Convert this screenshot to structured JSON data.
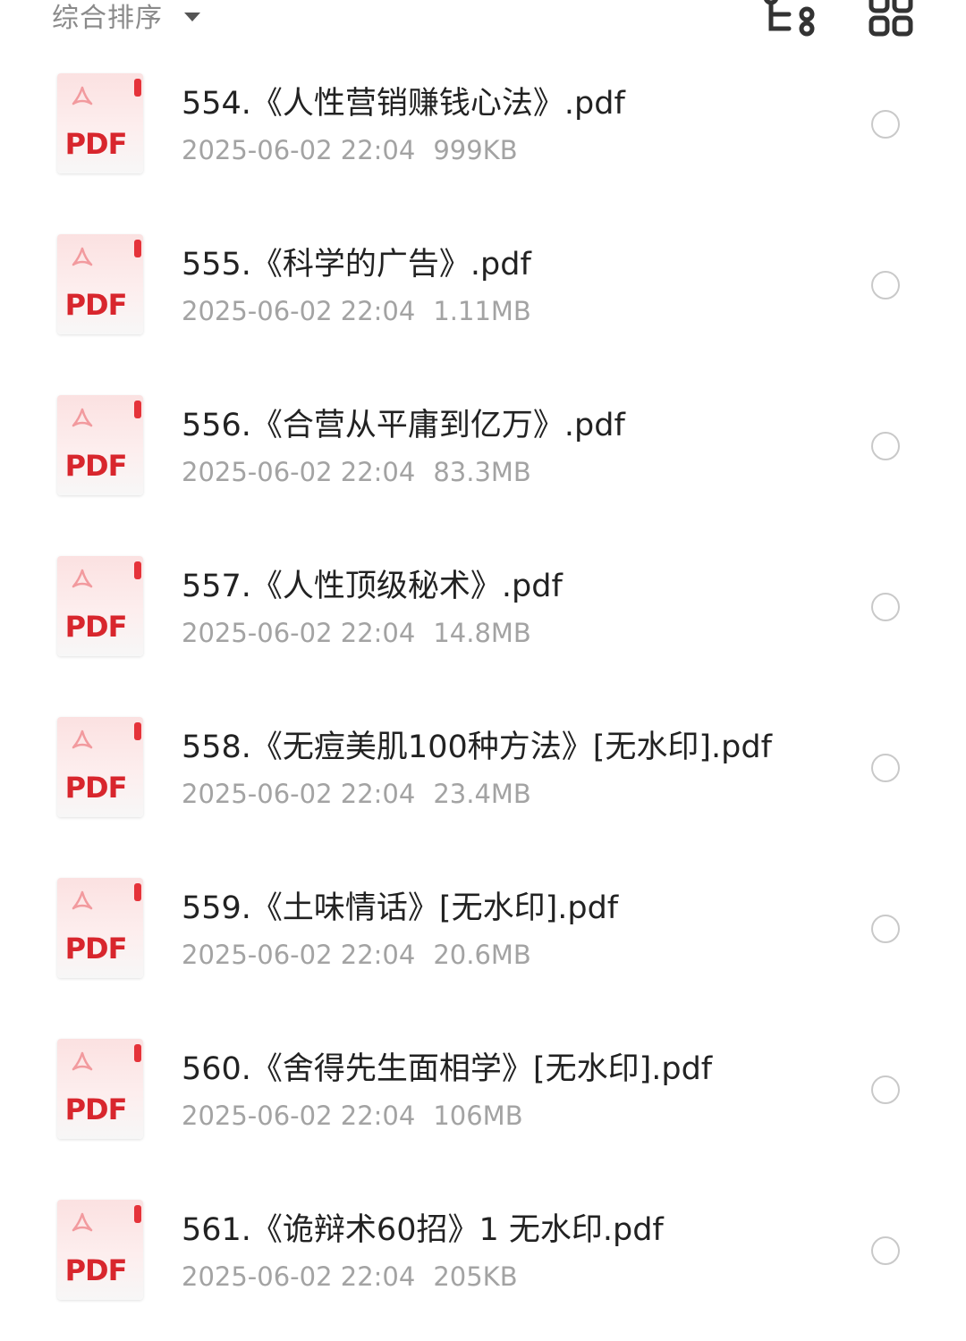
{
  "toolbar": {
    "sort_label": "综合排序",
    "icons": {
      "sort_caret": "caret-down-icon",
      "tree_view": "tree-view-icon",
      "grid_view": "grid-view-icon"
    }
  },
  "colors": {
    "pdf_red": "#d8262d",
    "meta_gray": "#a3a3a3",
    "radio_gray": "#c9c9c9"
  },
  "file_type_label": "PDF",
  "files": [
    {
      "name": "554.《人性营销赚钱心法》.pdf",
      "date": "2025-06-02 22:04",
      "size": "999KB"
    },
    {
      "name": "555.《科学的广告》.pdf",
      "date": "2025-06-02 22:04",
      "size": "1.11MB"
    },
    {
      "name": "556.《合营从平庸到亿万》.pdf",
      "date": "2025-06-02 22:04",
      "size": "83.3MB"
    },
    {
      "name": "557.《人性顶级秘术》.pdf",
      "date": "2025-06-02 22:04",
      "size": "14.8MB"
    },
    {
      "name": "558.《无痘美肌100种方法》[无水印].pdf",
      "date": "2025-06-02 22:04",
      "size": "23.4MB"
    },
    {
      "name": "559.《土味情话》[无水印].pdf",
      "date": "2025-06-02 22:04",
      "size": "20.6MB"
    },
    {
      "name": "560.《舍得先生面相学》[无水印].pdf",
      "date": "2025-06-02 22:04",
      "size": "106MB"
    },
    {
      "name": "561.《诡辩术60招》1 无水印.pdf",
      "date": "2025-06-02 22:04",
      "size": "205KB"
    }
  ]
}
